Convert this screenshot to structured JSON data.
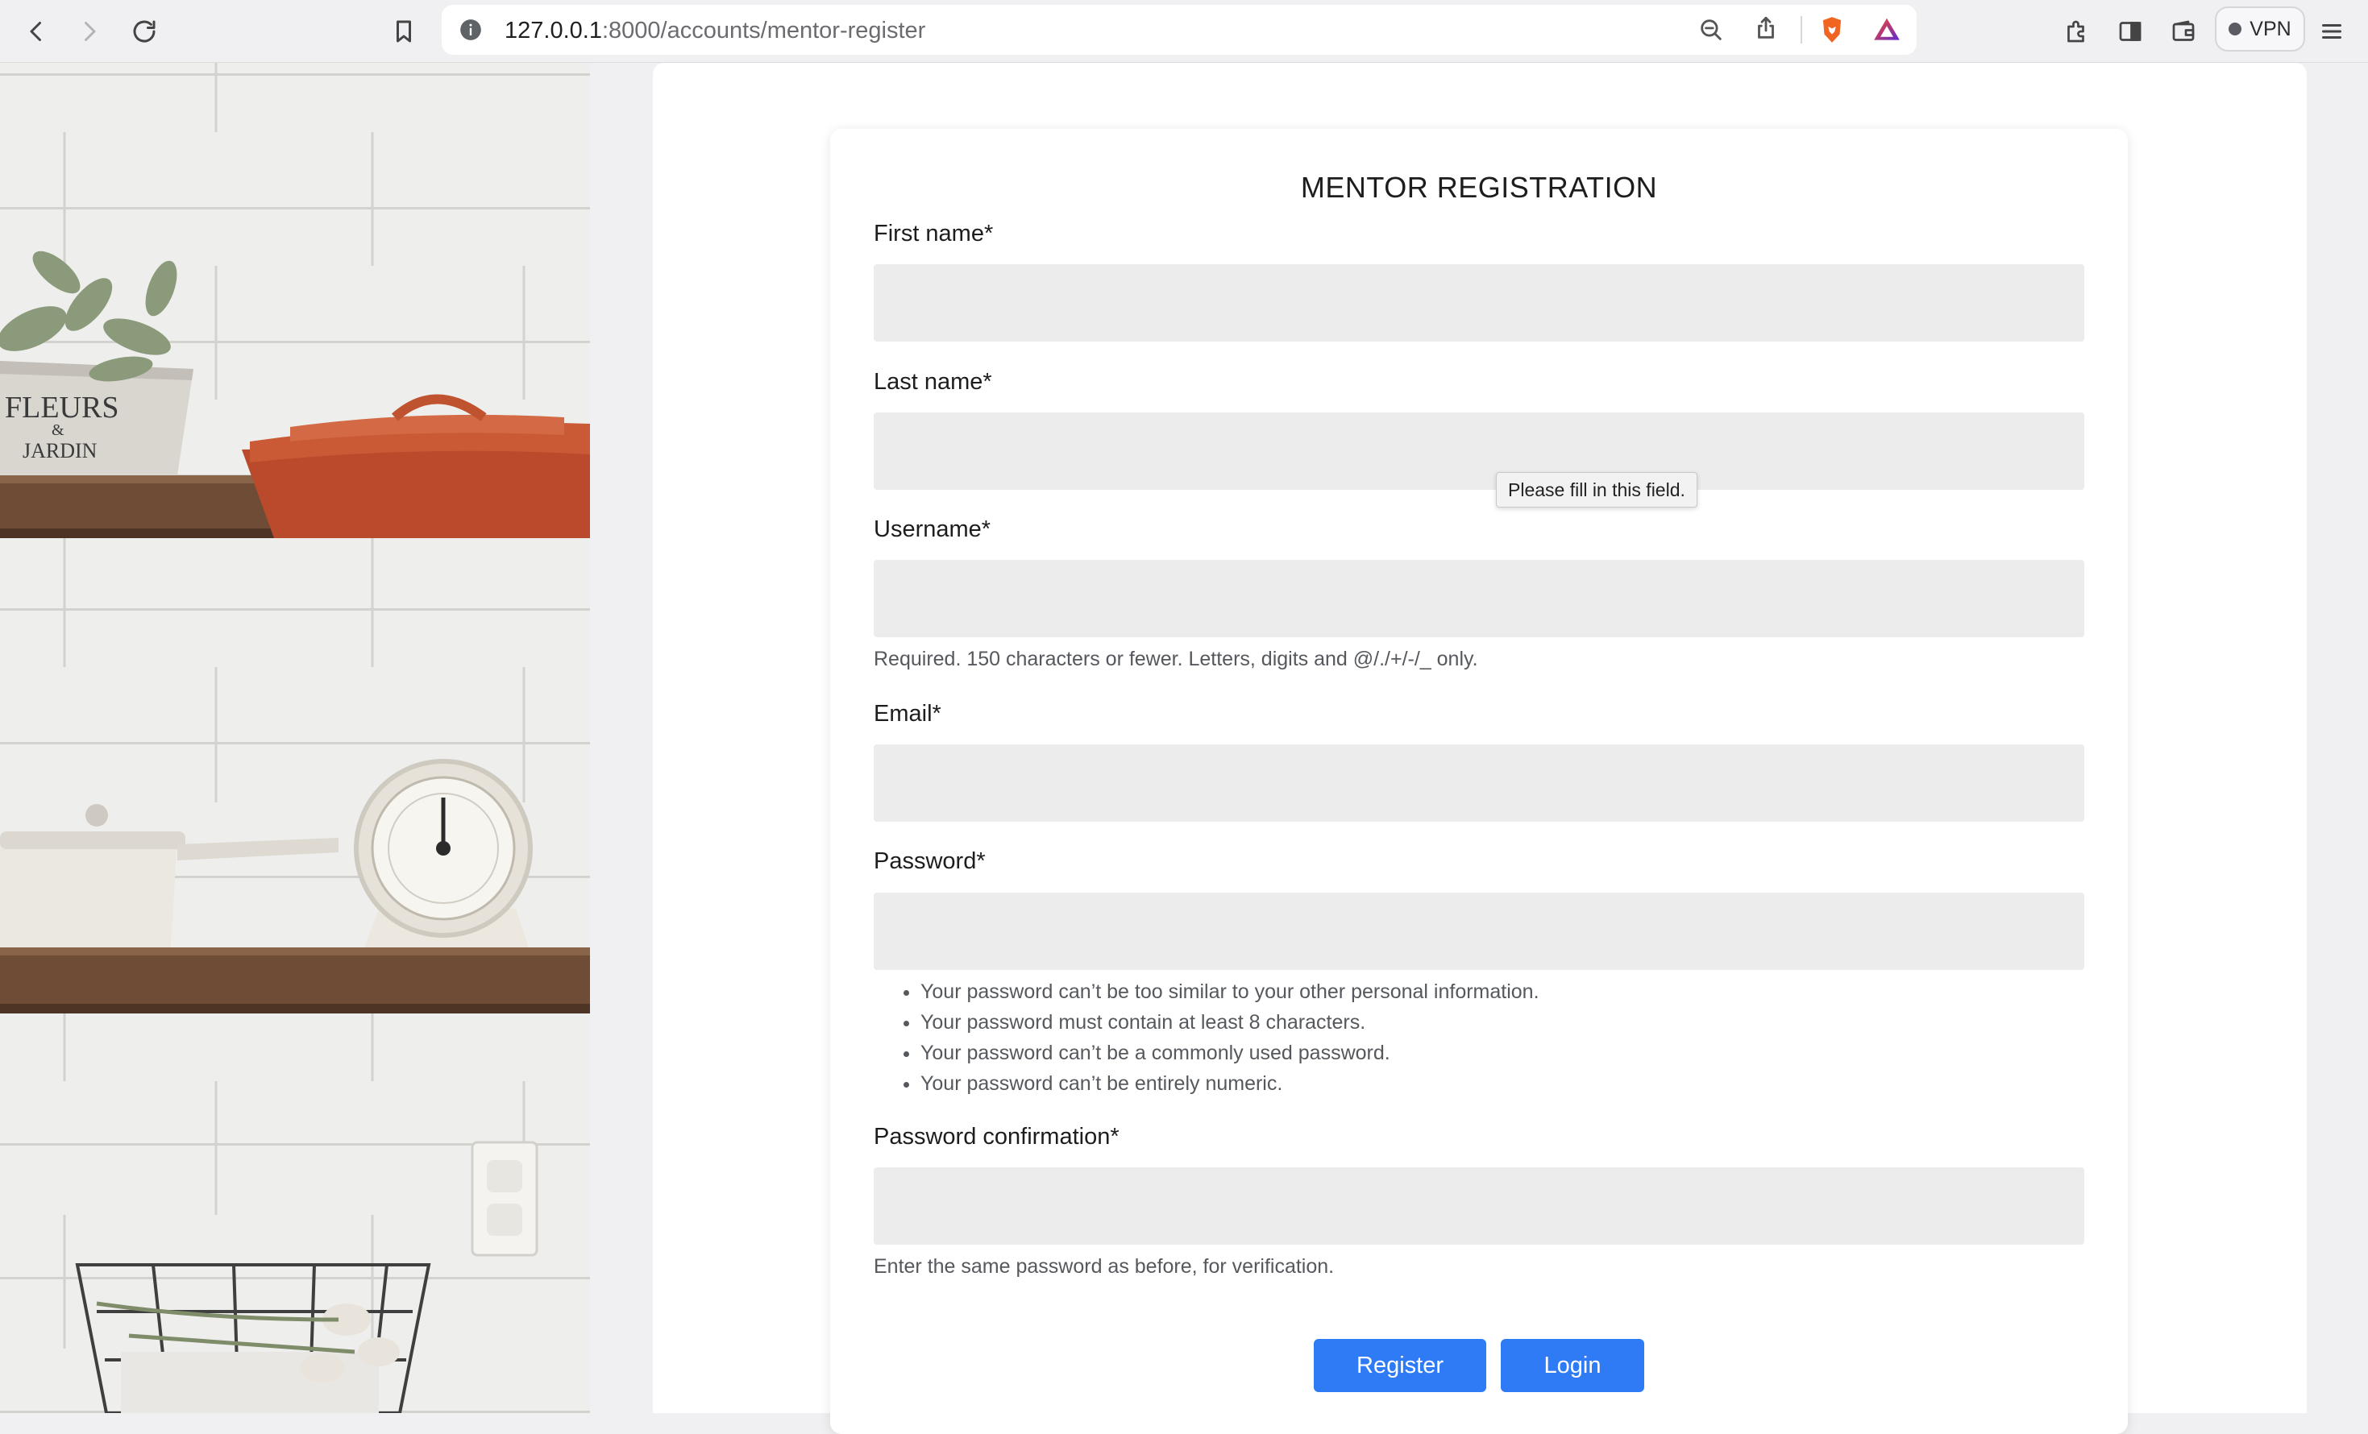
{
  "browser": {
    "url_host": "127.0.0.1",
    "url_path": ":8000/accounts/mentor-register",
    "vpn_label": "VPN",
    "icons": [
      "back-icon",
      "forward-icon",
      "reload-icon",
      "bookmark-icon",
      "info-icon",
      "zoom-out-icon",
      "share-icon",
      "brave-shields-icon",
      "brave-rewards-icon",
      "extensions-icon",
      "sidebar-icon",
      "wallet-icon",
      "menu-icon"
    ]
  },
  "form": {
    "title": "MENTOR REGISTRATION",
    "fields": [
      {
        "label": "First name*",
        "value": ""
      },
      {
        "label": "Last name*",
        "value": ""
      },
      {
        "label": "Username*",
        "value": "",
        "help": "Required. 150 characters or fewer. Letters, digits and @/./+/-/_ only."
      },
      {
        "label": "Email*",
        "value": ""
      },
      {
        "label": "Password*",
        "value": ""
      },
      {
        "label": "Password confirmation*",
        "value": "",
        "help": "Enter the same password as before, for verification."
      }
    ],
    "password_rules": [
      "Your password can’t be too similar to your other personal information.",
      "Your password must contain at least 8 characters.",
      "Your password can’t be a commonly used password.",
      "Your password can’t be entirely numeric."
    ],
    "register_label": "Register",
    "login_label": "Login",
    "validation_tooltip": "Please fill in this field."
  },
  "decor": {
    "pot_text_top": "FLEURS",
    "pot_text_mid": "&",
    "pot_text_bottom": "JARDIN"
  },
  "colors": {
    "accent": "#2f7bf5",
    "input_bg": "#ececec"
  }
}
